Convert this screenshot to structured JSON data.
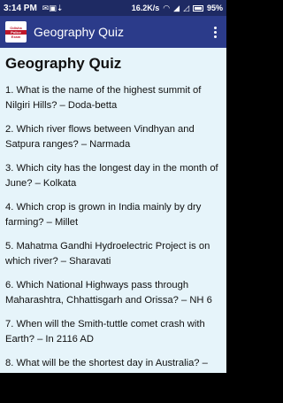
{
  "status_bar": {
    "time": "3:14 PM",
    "net_speed": "16.2K/s",
    "battery": "95%"
  },
  "app_bar": {
    "logo_lines": [
      "Odisha",
      "Police",
      "Exam"
    ],
    "title": "Geography Quiz"
  },
  "content": {
    "heading": "Geography Quiz",
    "questions": [
      "1. What is the name of the highest summit of Nilgiri Hills? – Doda-betta",
      "2. Which river flows between Vindhyan and Satpura ranges? – Narmada",
      "3. Which city has the longest day in the month of June? – Kolkata",
      "4. Which crop is grown in India mainly by dry farming? – Millet",
      "5. Mahatma Gandhi Hydroelectric Project is on which river? – Sharavati",
      "6. Which National Highways pass through Maharashtra, Chhattisgarh and Orissa? – NH 6",
      "7. When will the Smith-tuttle comet crash with Earth? – In 2116 AD",
      "8. What will be the shortest day in Australia? –"
    ]
  }
}
